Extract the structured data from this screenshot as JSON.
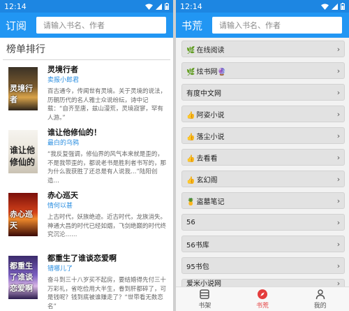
{
  "left": {
    "status": {
      "time": "12:14"
    },
    "appbar": {
      "title": "订阅",
      "search_placeholder": "请输入书名、作者"
    },
    "section_title": "榜单排行",
    "books": [
      {
        "title": "灵境行者",
        "author": "卖报小郎君",
        "desc": "百古通今，传闻世有灵境。关于灵境的说法，历朝历代的名人雅士众说纷纭，诗中记载：“自齐至唐，兹山漫荒，灵境寂寥，罕有人游。”",
        "cover_text": "灵境行者"
      },
      {
        "title": "谁让他修仙的！",
        "author": "最白的乌鸦",
        "desc": "“我反复强调，修仙界的风气本来就是歪的，不是我带歪的，都说老书是胜利者书写的，那为什么我获胜了还总是有人说我…”陆阳创造…",
        "cover_text": "谁让他修仙的"
      },
      {
        "title": "赤心巡天",
        "author": "情何以甚",
        "desc": "上古时代，妖族绝迹。近古时代，龙族消失。神通大昌的时代已经如烟，飞剑绝巅的时代终究沉沦……",
        "cover_text": "赤心巡天"
      },
      {
        "title": "都重生了谁谈恋爱啊",
        "author": "错哪儿了",
        "desc": "奋斗到三十八岁买不起房，要结婚得先付三十万彩礼，省吃俭用大半生，眷到肝都碎了，可是钱呢？钱到底被谁赚走了？“世带看无数恋名”",
        "cover_text": "都重生了谁谈恋爱啊"
      }
    ]
  },
  "right": {
    "status": {
      "time": "12:14"
    },
    "appbar": {
      "title": "书荒",
      "search_placeholder": "请输入书名、作者"
    },
    "items": [
      {
        "label": "在线阅读",
        "emoji": "🌿"
      },
      {
        "label": "炫书网",
        "emoji": "🌿",
        "suffix": "🔮"
      },
      {
        "label": "有度中文网",
        "emoji": ""
      },
      {
        "label": "阿姿小说",
        "emoji": "👍"
      },
      {
        "label": "落尘小说",
        "emoji": "👍"
      },
      {
        "label": "去看看",
        "emoji": "👍"
      },
      {
        "label": "玄幻阁",
        "emoji": "👍"
      },
      {
        "label": "盗墓笔记",
        "emoji": "🍍"
      },
      {
        "label": "56",
        "emoji": ""
      },
      {
        "label": "56书库",
        "emoji": ""
      },
      {
        "label": "95书包",
        "emoji": ""
      },
      {
        "label": "爱米小说网",
        "emoji": ""
      }
    ],
    "chevron": "›",
    "nav": [
      {
        "label": "书架",
        "icon": "bookshelf-icon"
      },
      {
        "label": "书荒",
        "icon": "compass-icon",
        "active": true
      },
      {
        "label": "我的",
        "icon": "person-icon"
      }
    ],
    "colors": {
      "primary": "#2196f3",
      "active_nav": "#e43c3c",
      "author": "#2a8ee0"
    }
  }
}
